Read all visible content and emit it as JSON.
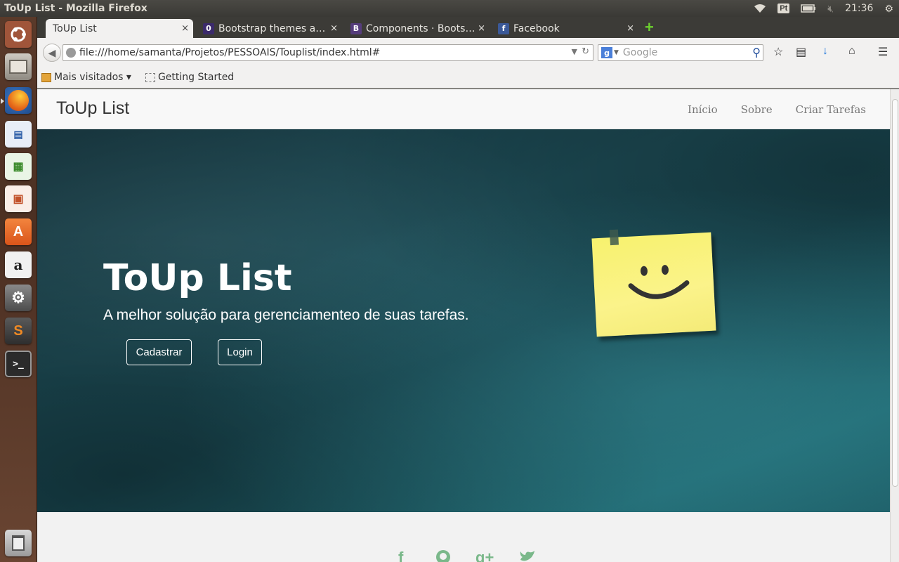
{
  "os": {
    "window_title": "ToUp List - Mozilla Firefox",
    "keyboard_layout": "Pt",
    "clock": "21:36"
  },
  "browser": {
    "tabs": [
      {
        "label": "ToUp List",
        "active": true
      },
      {
        "label": "Bootstrap themes a…",
        "favicon": "0",
        "favicon_color": "#3b2a6b"
      },
      {
        "label": "Components · Boots…",
        "favicon": "B",
        "favicon_color": "#563d7c"
      },
      {
        "label": "Facebook",
        "favicon": "f",
        "favicon_color": "#3b5998"
      }
    ],
    "close_glyph": "×",
    "url": "file:///home/samanta/Projetos/PESSOAIS/Touplist/index.html#",
    "search_placeholder": "Google",
    "bookmarks": [
      {
        "label": "Mais visitados ▾"
      },
      {
        "label": "Getting Started"
      }
    ]
  },
  "site": {
    "brand": "ToUp List",
    "nav": [
      "Início",
      "Sobre",
      "Criar Tarefas"
    ],
    "hero": {
      "title": "ToUp List",
      "subtitle": "A melhor solução para gerenciamenteo de suas tarefas.",
      "buttons": [
        "Cadastrar",
        "Login"
      ]
    },
    "social": [
      "facebook-icon",
      "github-icon",
      "google-plus-icon",
      "twitter-icon"
    ],
    "colors": {
      "hero_bg": "#1d4c56",
      "sticky_note": "#fbf38a",
      "social_green": "#7ab88a"
    }
  }
}
